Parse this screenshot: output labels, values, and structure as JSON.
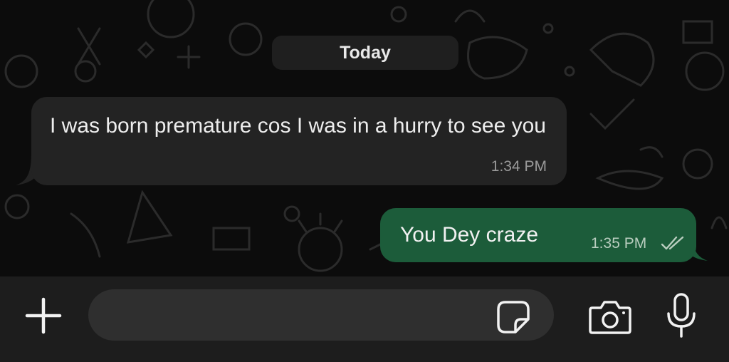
{
  "chat": {
    "date_separator": "Today",
    "messages": [
      {
        "direction": "incoming",
        "text": "I was born premature cos I was in a hurry to see you",
        "time": "1:34 PM"
      },
      {
        "direction": "outgoing",
        "text": "You Dey craze",
        "time": "1:35 PM",
        "status_icon": "double-check-icon"
      }
    ]
  },
  "input_bar": {
    "message_value": "",
    "placeholder": "",
    "icons": [
      "plus-icon",
      "sticker-icon",
      "camera-icon",
      "microphone-icon"
    ]
  },
  "colors": {
    "background": "#0c0c0c",
    "incoming_bubble": "#232323",
    "outgoing_bubble": "#1c5c3a",
    "input_bar": "#1d1d1d",
    "input_field": "#2f2f2f"
  }
}
